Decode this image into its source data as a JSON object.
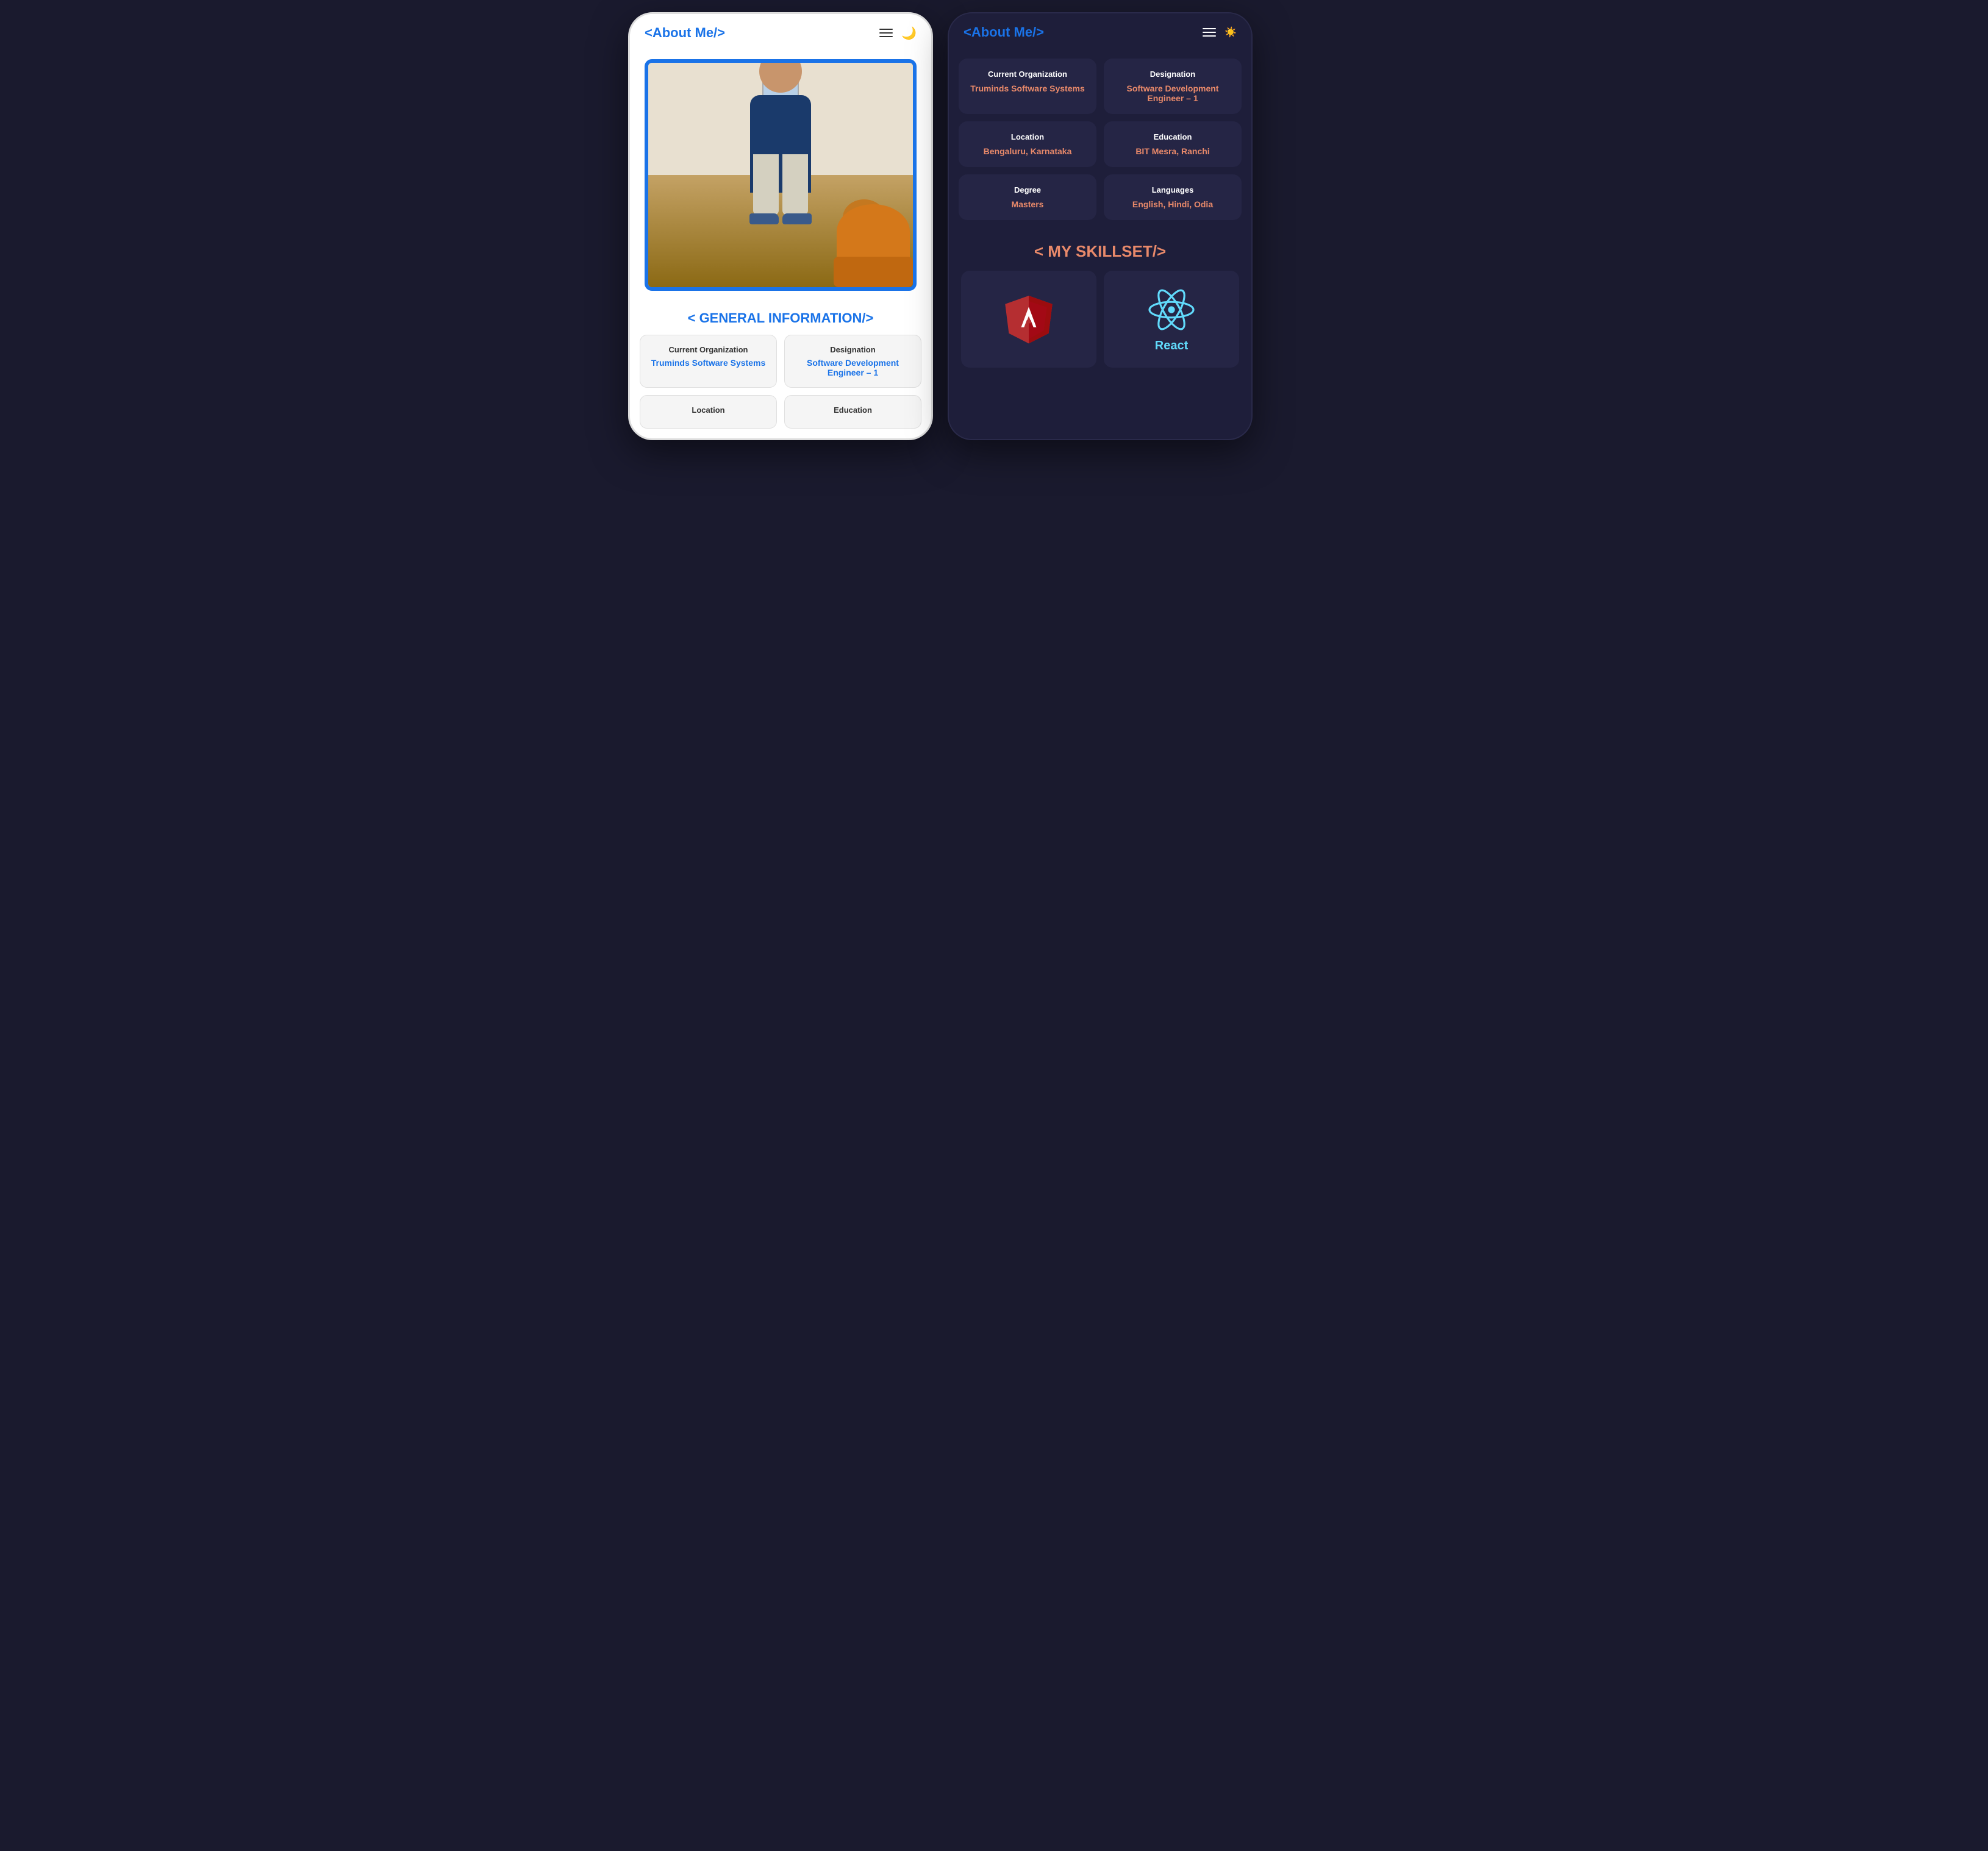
{
  "light_phone": {
    "navbar": {
      "logo": "<About Me/>",
      "menu_label": "menu",
      "theme_label": "dark mode"
    },
    "general_info_title": "< GENERAL INFORMATION/>",
    "info_cards": [
      {
        "label": "Current Organization",
        "value": "Truminds Software Systems"
      },
      {
        "label": "Designation",
        "value": "Software Development Engineer – 1"
      },
      {
        "label": "Location",
        "value": ""
      },
      {
        "label": "Education",
        "value": ""
      }
    ]
  },
  "dark_phone": {
    "navbar": {
      "logo": "<About Me/>",
      "menu_label": "menu",
      "theme_label": "light mode"
    },
    "info_cards": [
      {
        "label": "Current Organization",
        "value": "Truminds Software Systems"
      },
      {
        "label": "Designation",
        "value": "Software Development Engineer – 1"
      },
      {
        "label": "Location",
        "value": "Bengaluru, Karnataka"
      },
      {
        "label": "Education",
        "value": "BIT Mesra, Ranchi"
      },
      {
        "label": "Degree",
        "value": "Masters"
      },
      {
        "label": "Languages",
        "value": "English, Hindi, Odia"
      }
    ],
    "skillset_title": "< MY SKILLSET/>",
    "skills": [
      {
        "name": "Angular",
        "type": "angular"
      },
      {
        "name": "React",
        "type": "react"
      }
    ]
  }
}
